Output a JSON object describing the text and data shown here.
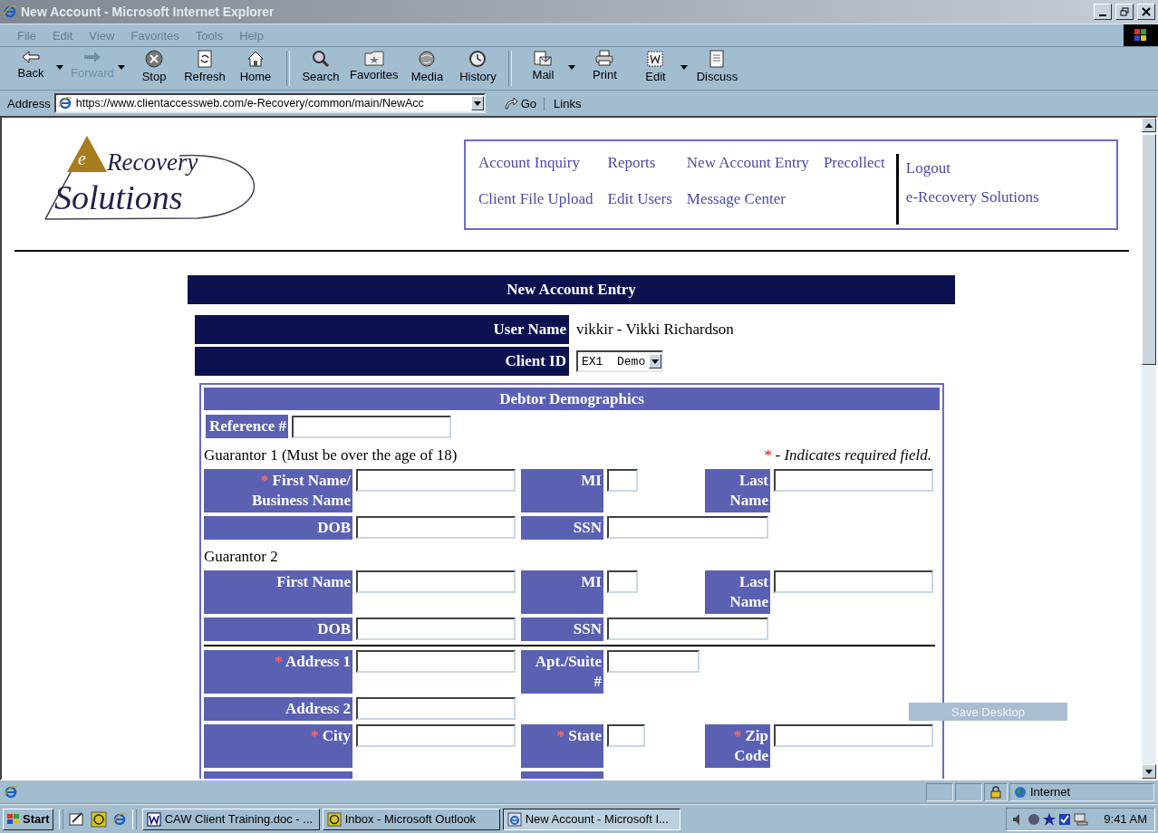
{
  "window": {
    "title": "New Account - Microsoft Internet Explorer"
  },
  "menu": [
    "File",
    "Edit",
    "View",
    "Favorites",
    "Tools",
    "Help"
  ],
  "toolbar": [
    [
      {
        "label": "Back",
        "disabled": false,
        "dropdown": true
      },
      {
        "label": "Forward",
        "disabled": true,
        "dropdown": true
      },
      {
        "label": "Stop",
        "disabled": false,
        "dropdown": false
      },
      {
        "label": "Refresh",
        "disabled": false,
        "dropdown": false
      },
      {
        "label": "Home",
        "disabled": false,
        "dropdown": false
      }
    ],
    [
      {
        "label": "Search",
        "disabled": false,
        "dropdown": false
      },
      {
        "label": "Favorites",
        "disabled": false,
        "dropdown": false
      },
      {
        "label": "Media",
        "disabled": false,
        "dropdown": false
      },
      {
        "label": "History",
        "disabled": false,
        "dropdown": false
      }
    ],
    [
      {
        "label": "Mail",
        "disabled": false,
        "dropdown": true
      },
      {
        "label": "Print",
        "disabled": false,
        "dropdown": false
      },
      {
        "label": "Edit",
        "disabled": false,
        "dropdown": true
      },
      {
        "label": "Discuss",
        "disabled": false,
        "dropdown": false
      }
    ]
  ],
  "address": {
    "label": "Address",
    "url": "https://www.clientaccessweb.com/e-Recovery/common/main/NewAcc",
    "go": "Go",
    "links": "Links"
  },
  "page": {
    "logo": {
      "initial": "e",
      "line1": "Recovery",
      "line2": "Solutions"
    },
    "nav": {
      "links": [
        "Account Inquiry",
        "Reports",
        "New Account Entry",
        "Precollect",
        "Client File Upload",
        "Edit Users",
        "Message Center"
      ],
      "side_links": [
        "Logout",
        "e-Recovery Solutions"
      ]
    },
    "form": {
      "title": "New Account Entry",
      "user": {
        "label": "User Name",
        "value": "vikkir - Vikki Richardson"
      },
      "client": {
        "label": "Client ID",
        "value": "EX1  Demo"
      },
      "section": {
        "title": "Debtor Demographics",
        "reference_label": "Reference #",
        "rows": [
          {
            "kind": "note",
            "text": "Guarantor 1 (Must be over the age of 18)",
            "legend": {
              "mark": "*",
              "text": "- Indicates required field."
            }
          },
          {
            "kind": "cells",
            "cells": [
              {
                "kind": "label",
                "text": "First Name/ Business Name",
                "mark": "*"
              },
              {
                "kind": "long_field"
              },
              {
                "kind": "label",
                "text": "MI"
              },
              {
                "kind": "tiny_field"
              },
              {
                "kind": "label",
                "text": "Last Name"
              },
              {
                "kind": "long_field"
              }
            ]
          },
          {
            "kind": "cells",
            "cells": [
              {
                "kind": "label",
                "text": "DOB"
              },
              {
                "kind": "long_field"
              },
              {
                "kind": "label",
                "text": "SSN"
              },
              {
                "kind": "wide_field"
              }
            ]
          },
          {
            "kind": "note",
            "text": "Guarantor 2"
          },
          {
            "kind": "cells",
            "cells": [
              {
                "kind": "label",
                "text": "First Name"
              },
              {
                "kind": "long_field"
              },
              {
                "kind": "label",
                "text": "MI"
              },
              {
                "kind": "tiny_field"
              },
              {
                "kind": "label",
                "text": "Last Name"
              },
              {
                "kind": "long_field"
              }
            ]
          },
          {
            "kind": "cells",
            "cells": [
              {
                "kind": "label",
                "text": "DOB"
              },
              {
                "kind": "long_field"
              },
              {
                "kind": "label",
                "text": "SSN"
              },
              {
                "kind": "wide_field"
              }
            ]
          },
          {
            "kind": "rule"
          },
          {
            "kind": "cells",
            "cells": [
              {
                "kind": "label",
                "text": "Address 1",
                "mark": "*"
              },
              {
                "kind": "long_field"
              },
              {
                "kind": "label",
                "text": "Apt./Suite #"
              },
              {
                "kind": "mid_field"
              }
            ]
          },
          {
            "kind": "cells",
            "cells": [
              {
                "kind": "label",
                "text": "Address 2"
              },
              {
                "kind": "long_field"
              }
            ]
          },
          {
            "kind": "cells",
            "cells": [
              {
                "kind": "label",
                "text": "City",
                "mark": "*"
              },
              {
                "kind": "long_field"
              },
              {
                "kind": "label",
                "text": "State",
                "mark": "*"
              },
              {
                "kind": "short_field"
              },
              {
                "kind": "label",
                "text": "Zip Code",
                "mark": "*"
              },
              {
                "kind": "long_field"
              }
            ]
          }
        ]
      }
    }
  },
  "overlay": {
    "label": "Save Desktop"
  },
  "status_bar": {
    "zone": "Internet"
  },
  "taskbar": {
    "start": "Start",
    "tasks": [
      {
        "label": "CAW Client Training.doc - ...",
        "selected": false
      },
      {
        "label": "Inbox - Microsoft Outlook",
        "selected": false
      },
      {
        "label": "New Account - Microsoft I...",
        "selected": true
      }
    ],
    "clock": "9:41 AM"
  }
}
